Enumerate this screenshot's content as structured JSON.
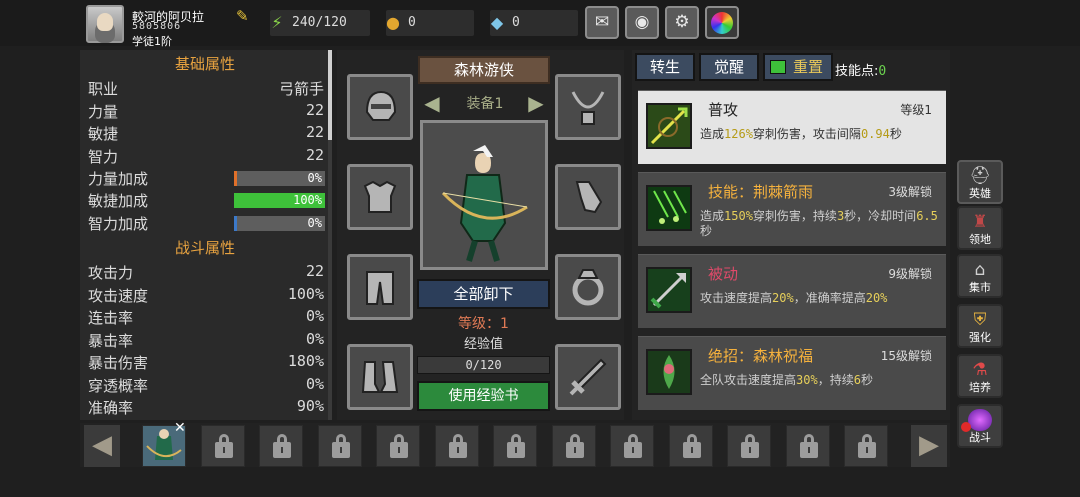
{
  "player": {
    "name": "較河的阿贝拉",
    "id": "5805806",
    "rank": "学徒1阶"
  },
  "resources": {
    "energy": "240/120",
    "gold": "0",
    "gems": "0"
  },
  "top_buttons": [
    "mail-icon",
    "gamepad-icon",
    "gear-icon",
    "color-wheel-icon"
  ],
  "stats": {
    "basic_title": "基础属性",
    "class_label": "职业",
    "class_value": "弓箭手",
    "str_label": "力量",
    "str_value": "22",
    "agi_label": "敏捷",
    "agi_value": "22",
    "int_label": "智力",
    "int_value": "22",
    "str_bonus_label": "力量加成",
    "str_bonus_value": "0%",
    "str_bonus_fraction": 0.03,
    "agi_bonus_label": "敏捷加成",
    "agi_bonus_value": "100%",
    "agi_bonus_fraction": 1.0,
    "int_bonus_label": "智力加成",
    "int_bonus_value": "0%",
    "int_bonus_fraction": 0.03,
    "combat_title": "战斗属性",
    "atk_label": "攻击力",
    "atk_value": "22",
    "aspd_label": "攻击速度",
    "aspd_value": "100%",
    "combo_label": "连击率",
    "combo_value": "0%",
    "crit_label": "暴击率",
    "crit_value": "0%",
    "critdmg_label": "暴击伤害",
    "critdmg_value": "180%",
    "pierce_label": "穿透概率",
    "pierce_value": "0%",
    "acc_label": "准确率",
    "acc_value": "90%"
  },
  "equipment": {
    "class_banner": "森林游侠",
    "equip_label": "装备1",
    "unequip_all": "全部卸下",
    "level_text": "等级：1",
    "xp_label": "经验值",
    "xp_value": "0/120",
    "xp_fraction": 0,
    "use_book": "使用经验书",
    "slots": [
      "helmet-icon",
      "necklace-icon",
      "armor-icon",
      "gloves-icon",
      "pants-icon",
      "ring-icon",
      "boots-icon",
      "sword-icon"
    ]
  },
  "skills_panel": {
    "tab_rebirth": "转生",
    "tab_awaken": "觉醒",
    "tab_reset": "重置",
    "points_label": "技能点:",
    "points_value": "0",
    "skills": [
      {
        "name": "普攻",
        "level": "等级1",
        "desc_a": "造成",
        "v1": "126%",
        "desc_b": "穿刺伤害，攻击间隔",
        "v2": "0.94",
        "desc_c": "秒"
      },
      {
        "name": "技能：荆棘箭雨",
        "level": "3级解锁",
        "desc_a": "造成",
        "v1": "150%",
        "desc_b": "穿刺伤害，持续",
        "v2": "3",
        "desc_c": "秒，冷却时间",
        "v3": "6.5",
        "desc_d": "秒"
      },
      {
        "name": "被动",
        "level": "9级解锁",
        "desc_a": "攻击速度提高",
        "v1": "20%",
        "desc_b": "，准确率提高",
        "v2": "20%"
      },
      {
        "name": "绝招：森林祝福",
        "level": "15级解锁",
        "desc_a": "全队攻击速度提高",
        "v1": "30%",
        "desc_b": "，持续",
        "v2": "6",
        "desc_c": "秒"
      }
    ]
  },
  "nav": {
    "hero": "英雄",
    "territory": "领地",
    "market": "集市",
    "enhance": "强化",
    "train": "培养",
    "battle": "战斗"
  },
  "colors": {
    "gold_text": "#e8a340",
    "green_bar": "#3ec13a",
    "orange_bar": "#e0702a",
    "blue_bar": "#3c79c8",
    "points_green": "#6cd34f"
  }
}
